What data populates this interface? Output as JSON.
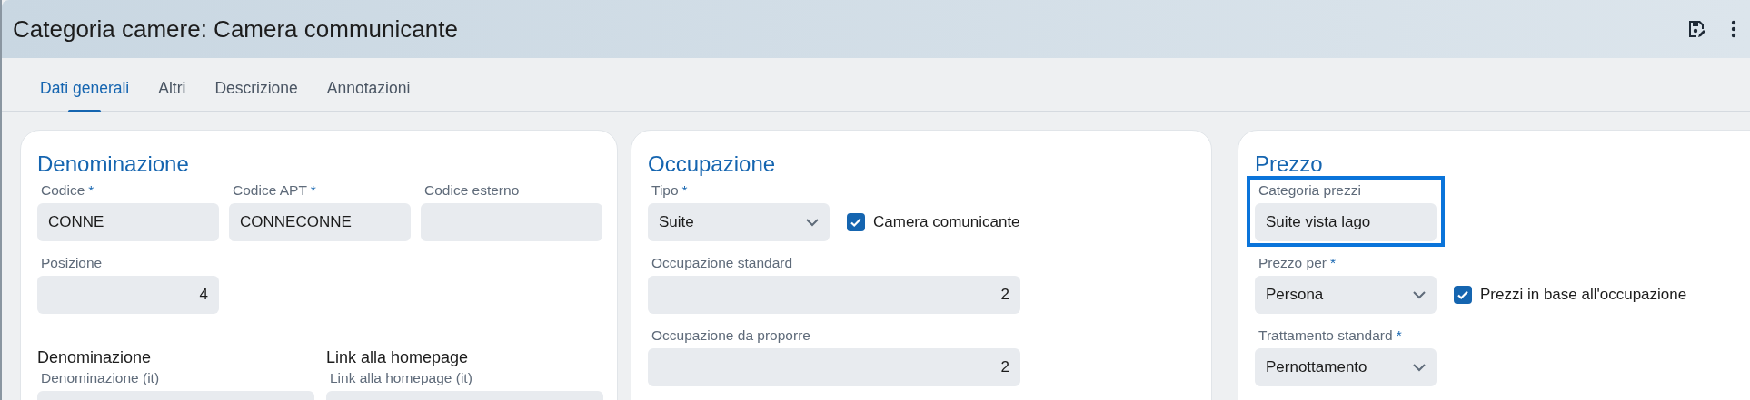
{
  "window": {
    "title": "Categoria camere: Camera communicante"
  },
  "tabs": [
    {
      "label": "Dati generali",
      "selected": true
    },
    {
      "label": "Altri",
      "selected": false
    },
    {
      "label": "Descrizione",
      "selected": false
    },
    {
      "label": "Annotazioni",
      "selected": false
    }
  ],
  "cards": [
    {
      "title": "Denominazione",
      "rows": [
        {
          "kind": "fields",
          "items": [
            {
              "kind": "text",
              "label": "Codice",
              "mark": "*",
              "value": "CONNE",
              "focused": false
            },
            {
              "kind": "text",
              "label": "Codice APT",
              "mark": "*",
              "value": "CONNECONNE",
              "focused": false
            },
            {
              "kind": "text",
              "label": "Codice esterno",
              "focused": false
            }
          ]
        },
        {
          "kind": "fields",
          "items": [
            {
              "kind": "number",
              "label": "Posizione",
              "value": "4",
              "focused": false
            }
          ]
        },
        {
          "kind": "divider"
        },
        {
          "kind": "groups",
          "items": [
            {
              "heading": "Denominazione",
              "label": "Denominazione (it)"
            },
            {
              "heading": "Link alla homepage",
              "label": "Link alla homepage (it)"
            }
          ]
        }
      ]
    },
    {
      "title": "Occupazione",
      "rows": [
        {
          "kind": "fields",
          "items": [
            {
              "kind": "select",
              "label": "Tipo",
              "mark": "*",
              "value": "Suite",
              "focused": false
            },
            {
              "kind": "checkbox",
              "label": "Camera comunicante",
              "checked": true
            }
          ]
        },
        {
          "kind": "fields",
          "items": [
            {
              "kind": "number",
              "label": "Occupazione standard",
              "value": "2",
              "focused": false
            }
          ]
        },
        {
          "kind": "fields",
          "items": [
            {
              "kind": "number",
              "label": "Occupazione da proporre",
              "value": "2",
              "focused": false
            }
          ]
        }
      ]
    },
    {
      "title": "Prezzo",
      "rows": [
        {
          "kind": "fields",
          "items": [
            {
              "kind": "text",
              "label": "Categoria prezzi",
              "value": "Suite vista lago",
              "focused": true
            }
          ]
        },
        {
          "kind": "fields",
          "items": [
            {
              "kind": "select",
              "label": "Prezzo per",
              "mark": "*",
              "value": "Persona",
              "focused": false
            },
            {
              "kind": "checkbox",
              "label": "Prezzi in base all'occupazione",
              "checked": true
            }
          ]
        },
        {
          "kind": "fields",
          "items": [
            {
              "kind": "select",
              "label": "Trattamento standard",
              "mark": "*",
              "value": "Pernottamento",
              "focused": false
            }
          ]
        }
      ]
    }
  ]
}
